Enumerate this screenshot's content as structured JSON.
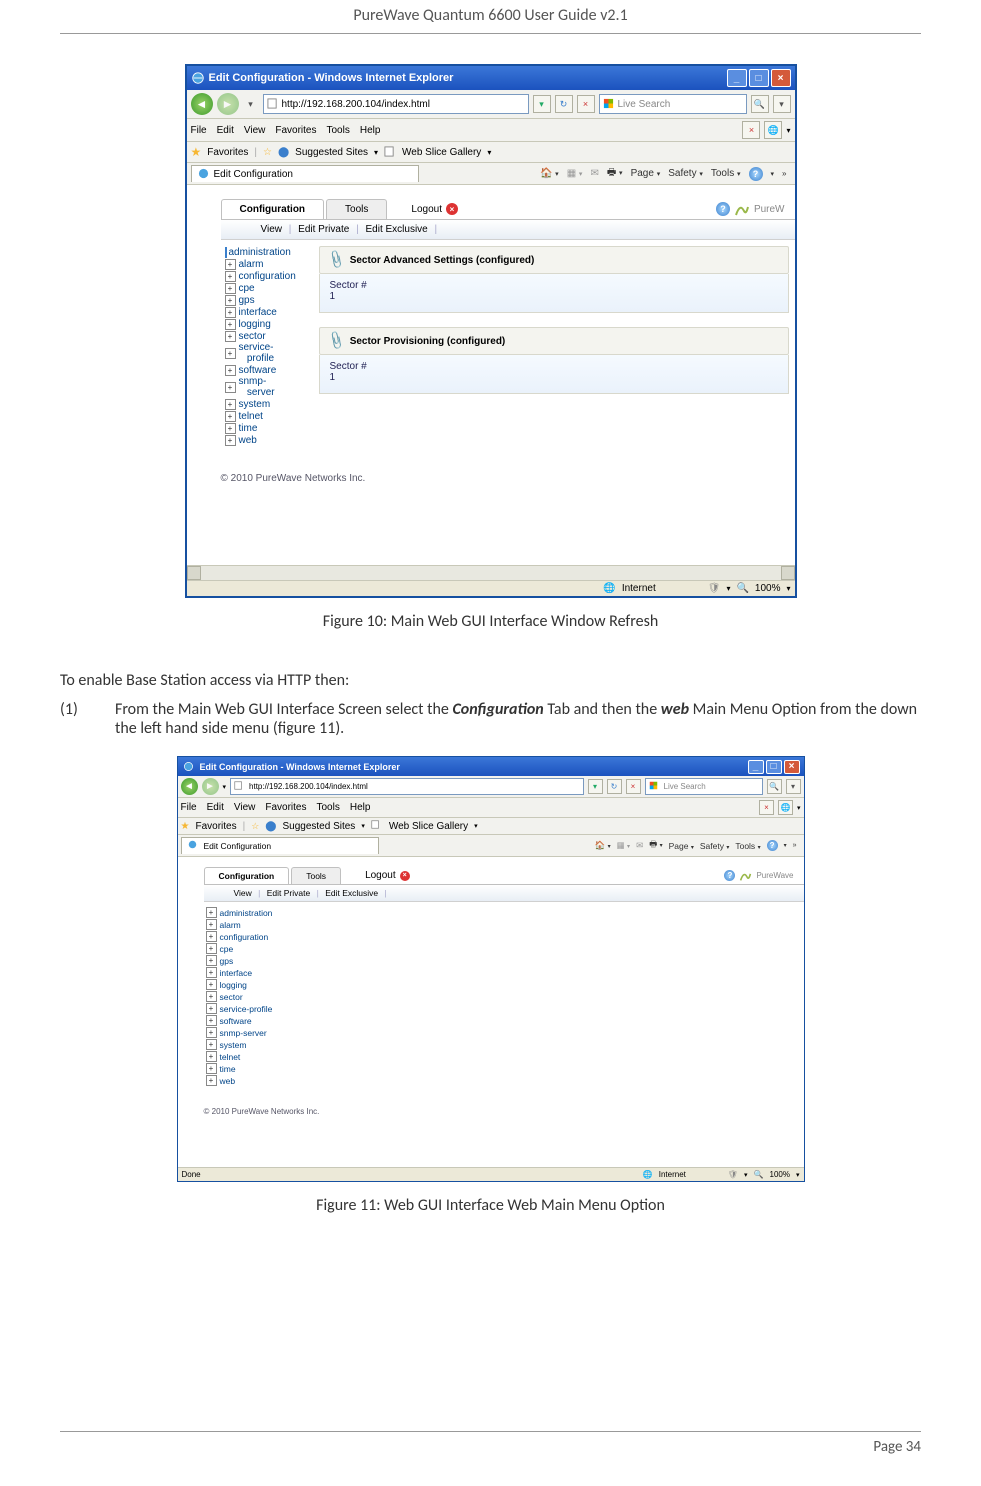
{
  "doc": {
    "header": "PureWave Quantum 6600 User Guide v2.1",
    "footer": "Page 34",
    "fig10_caption": "Figure 10: Main Web GUI Interface Window Refresh",
    "fig11_caption": "Figure 11: Web GUI Interface Web Main Menu Option",
    "intro_text": "To enable Base Station access via HTTP then:",
    "step1_num": "(1)",
    "step1_part1": "From the Main Web GUI Interface Screen select the ",
    "step1_bold1": "Configuration",
    "step1_part2": " Tab and then the ",
    "step1_bold2": "web",
    "step1_part3": " Main Menu Option from the down the left hand side menu (figure 11)."
  },
  "ie": {
    "title": "Edit Configuration - Windows Internet Explorer",
    "url": "http://192.168.200.104/index.html",
    "searchPlaceholder": "Live Search",
    "menu": {
      "file": "File",
      "edit": "Edit",
      "view": "View",
      "fav": "Favorites",
      "tools": "Tools",
      "help": "Help"
    },
    "favBar": {
      "label": "Favorites",
      "suggested": "Suggested Sites",
      "gallery": "Web Slice Gallery"
    },
    "tabTitle": "Edit Configuration",
    "cmdbar": {
      "page": "Page",
      "safety": "Safety",
      "tools": "Tools"
    },
    "status": {
      "internet": "Internet",
      "zoom": "100%",
      "done": "Done"
    }
  },
  "gui": {
    "tabs": {
      "config": "Configuration",
      "tools": "Tools",
      "logout": "Logout"
    },
    "brand": "PureW",
    "brand2": "PureWave",
    "subTabs": {
      "view": "View",
      "editPrivate": "Edit Private",
      "editExclusive": "Edit Exclusive"
    },
    "tree": [
      "administration",
      "alarm",
      "configuration",
      "cpe",
      "gps",
      "interface",
      "logging",
      "sector",
      "service-profile",
      "software",
      "snmp-server",
      "system",
      "telnet",
      "time",
      "web"
    ],
    "tree2": [
      "administration",
      "alarm",
      "configuration",
      "cpe",
      "gps",
      "interface",
      "logging",
      "sector",
      "service-profile",
      "software",
      "snmp-server",
      "system",
      "telnet",
      "time",
      "web"
    ],
    "section1": "Sector Advanced Settings (configured)",
    "section2": "Sector Provisioning (configured)",
    "sectorLabel": "Sector #",
    "sectorVal": "1",
    "copyright": "© 2010 PureWave Networks Inc."
  }
}
